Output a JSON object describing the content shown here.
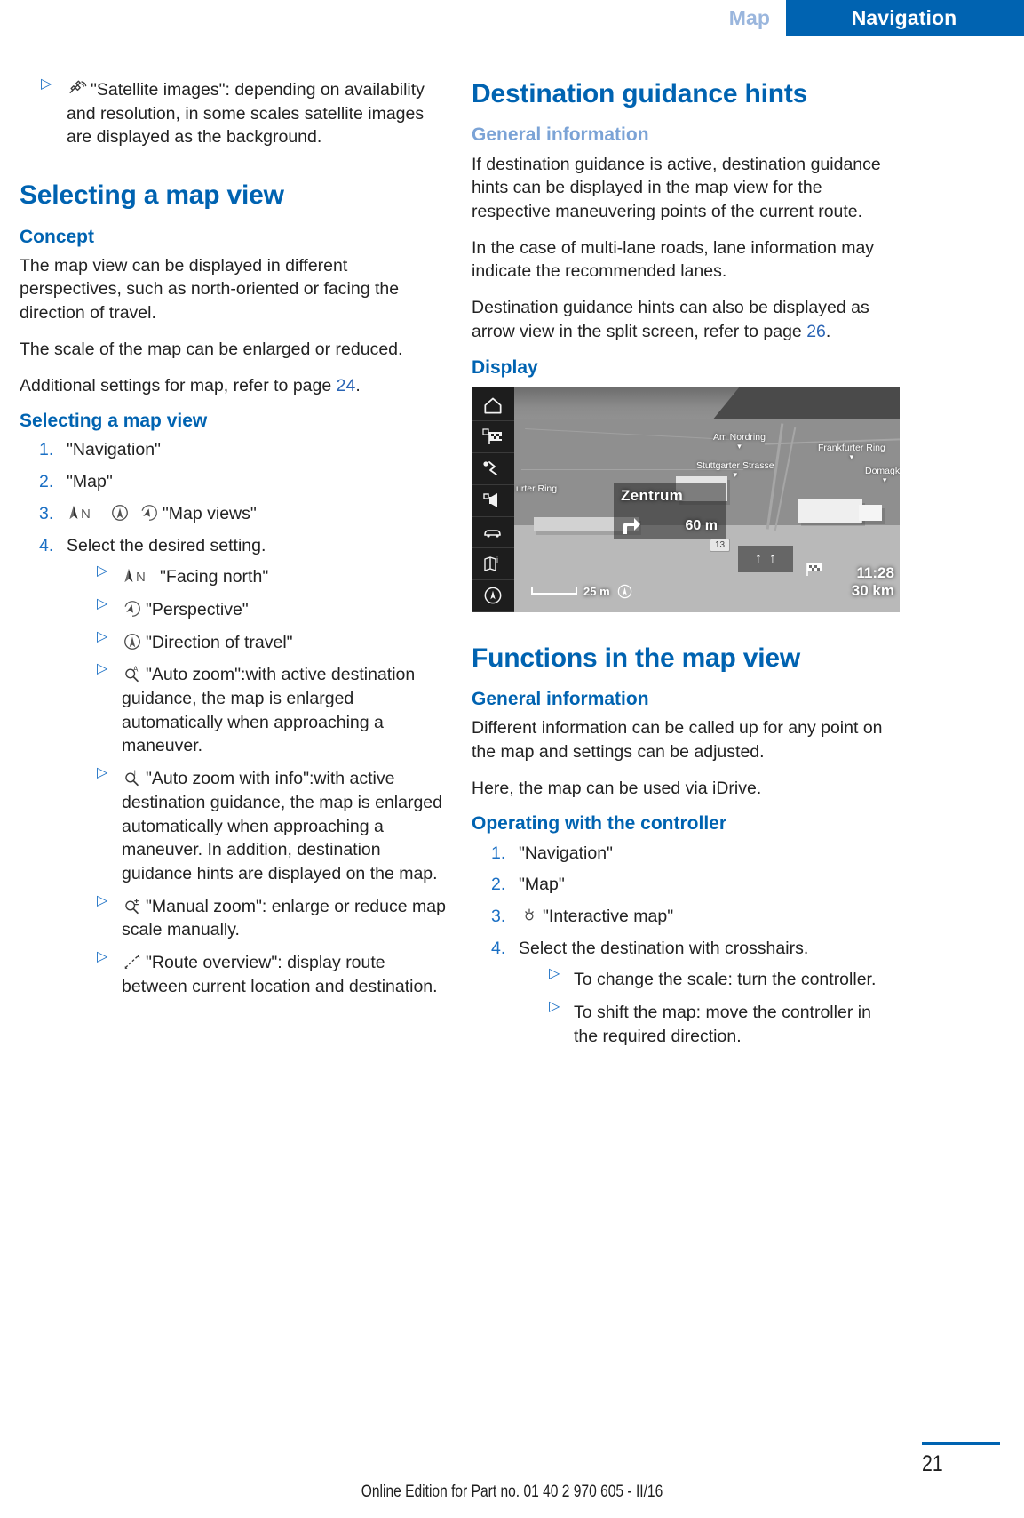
{
  "header": {
    "tab_inactive": "Map",
    "tab_active": "Navigation"
  },
  "colors": {
    "accent_blue": "#0063b1",
    "light_blue": "#7ba3d6",
    "link_blue": "#2a64b4"
  },
  "left_column": {
    "top_bullet": {
      "icon": "satellite-icon",
      "text": "\"Satellite images\": depending on availability and resolution, in some scales satellite images are displayed as the background."
    },
    "section_title": "Selecting a map view",
    "concept_heading": "Concept",
    "concept_paragraphs": [
      "The map view can be displayed in different perspectives, such as north-oriented or facing the direction of travel.",
      "The scale of the map can be enlarged or reduced."
    ],
    "additional_settings": {
      "before": "Additional settings for map, refer to page ",
      "page_ref": "24",
      "after": "."
    },
    "selecting_heading": "Selecting a map view",
    "steps": [
      {
        "text": "\"Navigation\"",
        "icons": []
      },
      {
        "text": "\"Map\"",
        "icons": []
      },
      {
        "text": "\"Map views\"",
        "icons": [
          "facing-north-icon",
          "direction-of-travel-icon",
          "perspective-icon"
        ]
      },
      {
        "text": "Select the desired setting.",
        "icons": []
      }
    ],
    "settings_bullets": [
      {
        "icon": "facing-north-icon",
        "text": "\"Facing north\""
      },
      {
        "icon": "perspective-icon",
        "text": "\"Perspective\""
      },
      {
        "icon": "direction-of-travel-icon",
        "text": "\"Direction of travel\""
      },
      {
        "icon": "auto-zoom-icon",
        "text": "\"Auto zoom\":with active destination guidance, the map is enlarged automatically when approaching a maneuver."
      },
      {
        "icon": "auto-zoom-with-info-icon",
        "text": "\"Auto zoom with info\":with active destination guidance, the map is enlarged automatically when approaching a maneuver. In addition, destination guidance hints are displayed on the map."
      },
      {
        "icon": "manual-zoom-icon",
        "text": "\"Manual zoom\": enlarge or reduce map scale manually."
      },
      {
        "icon": "route-overview-icon",
        "text": "\"Route overview\": display route between current location and destination."
      }
    ]
  },
  "right_column": {
    "dest_hints_title": "Destination guidance hints",
    "general_info_heading": "General information",
    "general_info_paragraphs": [
      "If destination guidance is active, destination guidance hints can be displayed in the map view for the respective maneuvering points of the current route.",
      "In the case of multi-lane roads, lane information may indicate the recommended lanes."
    ],
    "split_screen": {
      "before": "Destination guidance hints can also be displayed as arrow view in the split screen, refer to page ",
      "page_ref": "26",
      "after": "."
    },
    "display_heading": "Display",
    "display_image": {
      "sidebar_icons": [
        "home-icon",
        "checkered-flag-icon",
        "route-icon",
        "speaker-icon",
        "vehicle-icon",
        "map-info-icon",
        "compass-icon"
      ],
      "map_labels": [
        "Am Nordring",
        "Stuttgarter Strasse",
        "Frankfurter Ring",
        "Domagks",
        "urter Ring"
      ],
      "guidance_street": "Zentrum",
      "guidance_distance": "60 m",
      "guidance_maneuver": "turn-right-arrow",
      "scale_value": "25 m",
      "route_shield": "13",
      "eta_time": "11:28",
      "eta_distance": "30 km"
    },
    "functions_title": "Functions in the map view",
    "functions_general_heading": "General information",
    "functions_paragraphs": [
      "Different information can be called up for any point on the map and settings can be adjusted.",
      "Here, the map can be used via iDrive."
    ],
    "controller_heading": "Operating with the controller",
    "controller_steps": [
      {
        "text": "\"Navigation\"",
        "icons": []
      },
      {
        "text": "\"Map\"",
        "icons": []
      },
      {
        "text": "\"Interactive map\"",
        "icons": [
          "interactive-map-icon"
        ]
      },
      {
        "text": "Select the destination with crosshairs.",
        "icons": []
      }
    ],
    "controller_bullets": [
      "To change the scale: turn the controller.",
      "To shift the map: move the controller in the required direction."
    ]
  },
  "footer": {
    "text": "Online Edition for Part no. 01 40 2 970 605 - II/16",
    "page_number": "21"
  }
}
